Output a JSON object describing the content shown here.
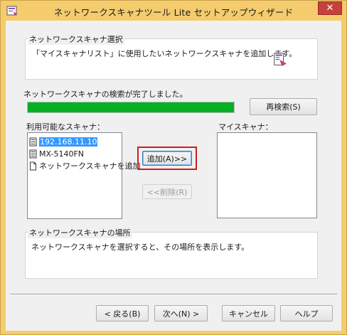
{
  "window": {
    "title": "ネットワークスキャナツール Lite セットアップウィザード",
    "close_glyph": "✕"
  },
  "select_group": {
    "title": "ネットワークスキャナ選択",
    "description": "「マイスキャナリスト」に使用したいネットワークスキャナを追加します。"
  },
  "search": {
    "status": "ネットワークスキャナの検索が完了しました。",
    "progress_percent": 100,
    "progress_color": "#06b025",
    "research_button": "再検索(S)"
  },
  "available": {
    "label": "利用可能なスキャナ：",
    "items": [
      {
        "icon": "scanner-icon",
        "text": "192.168.11.10",
        "selected": true
      },
      {
        "icon": "scanner-icon",
        "text": "MX-5140FN",
        "selected": false
      },
      {
        "icon": "page-icon",
        "text": "ネットワークスキャナを追加",
        "selected": false
      }
    ]
  },
  "my_scanner": {
    "label": "マイスキャナ："
  },
  "actions": {
    "add_button": "追加(A)>>",
    "remove_button": "<<削除(R)"
  },
  "location_group": {
    "title": "ネットワークスキャナの場所",
    "description": "ネットワークスキャナを選択すると、その場所を表示します。"
  },
  "footer": {
    "back": "< 戻る(B)",
    "next": "次へ(N) >",
    "cancel": "キャンセル",
    "help": "ヘルプ"
  },
  "colors": {
    "title_bar": "#f4cc6e",
    "close_button": "#c7413b",
    "highlight_box": "#cc1f1f",
    "selection": "#3399ff"
  }
}
